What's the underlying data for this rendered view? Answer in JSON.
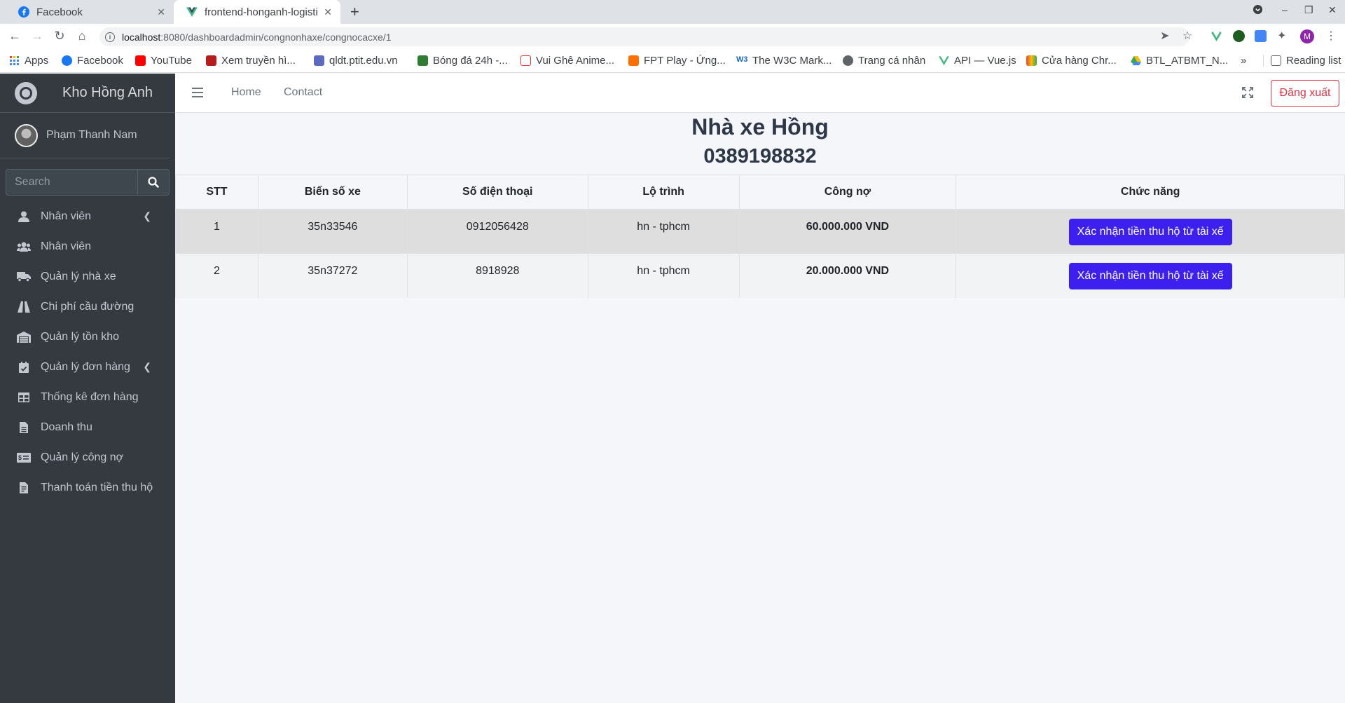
{
  "browser": {
    "tabs": [
      {
        "title": "Facebook",
        "active": false
      },
      {
        "title": "frontend-honganh-logisti",
        "active": true
      }
    ],
    "url_host": "localhost",
    "url_path": ":8080/dashboardadmin/congnonhaxe/congnocacxe/1",
    "profile_initial": "M",
    "bookmarks": [
      "Apps",
      "Facebook",
      "YouTube",
      "Xem truyền hì...",
      "qldt.ptit.edu.vn",
      "Bóng đá 24h -...",
      "Vui Ghê Anime...",
      "FPT Play - Ứng...",
      "The W3C Mark...",
      "Trang cá nhân",
      "API — Vue.js",
      "Cửa hàng Chr...",
      "BTL_ATBMT_N..."
    ],
    "more": "»",
    "reading_list": "Reading list"
  },
  "sidebar": {
    "brand": "Kho Hồng Anh",
    "user": "Phạm Thanh Nam",
    "search_placeholder": "Search",
    "items": [
      {
        "label": "Nhân viên",
        "icon": "user-icon",
        "chevron": true
      },
      {
        "label": "Nhân viên",
        "icon": "users-icon",
        "chevron": false
      },
      {
        "label": "Quản lý nhà xe",
        "icon": "truck-icon",
        "chevron": false
      },
      {
        "label": "Chi phí cầu đường",
        "icon": "road-icon",
        "chevron": false
      },
      {
        "label": "Quản lý tồn kho",
        "icon": "warehouse-icon",
        "chevron": false
      },
      {
        "label": "Quản lý đơn hàng",
        "icon": "calendar-check-icon",
        "chevron": true
      },
      {
        "label": "Thống kê đơn hàng",
        "icon": "table-icon",
        "chevron": false
      },
      {
        "label": "Doanh thu",
        "icon": "file-icon",
        "chevron": false
      },
      {
        "label": "Quản lý công nợ",
        "icon": "money-check-icon",
        "chevron": false
      },
      {
        "label": "Thanh toán tiền thu hộ",
        "icon": "receipt-icon",
        "chevron": false
      }
    ]
  },
  "topnav": {
    "home": "Home",
    "contact": "Contact",
    "logout": "Đăng xuất"
  },
  "page": {
    "name": "Nhà xe Hồng",
    "phone": "0389198832"
  },
  "table": {
    "headers": [
      "STT",
      "Biển số xe",
      "Số điện thoại",
      "Lộ trình",
      "Công nợ",
      "Chức năng"
    ],
    "rows": [
      {
        "stt": "1",
        "plate": "35n33546",
        "phone": "0912056428",
        "route": "hn - tphcm",
        "debt": "60.000.000 VND",
        "action": "Xác nhận tiền thu hộ từ tài xế"
      },
      {
        "stt": "2",
        "plate": "35n37272",
        "phone": "8918928",
        "route": "hn - tphcm",
        "debt": "20.000.000 VND",
        "action": "Xác nhận tiền thu hộ từ tài xế"
      }
    ]
  },
  "colors": {
    "sidebar_bg": "#343a40",
    "primary_button": "#3d1ff0",
    "logout_red": "#dc3545"
  }
}
